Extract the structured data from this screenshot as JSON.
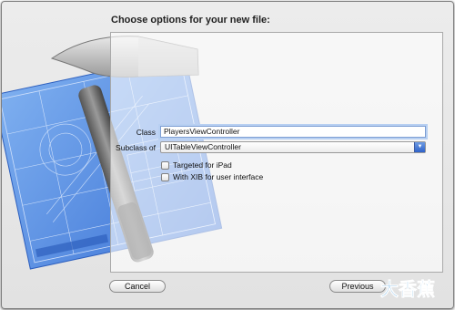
{
  "dialog": {
    "title": "Choose options for your new file:"
  },
  "form": {
    "class_label": "Class",
    "class_value": "PlayersViewController",
    "subclass_label": "Subclass of",
    "subclass_value": "UITableViewController",
    "ipad_label": "Targeted for iPad",
    "ipad_checked": false,
    "xib_label": "With XIB for user interface",
    "xib_checked": false
  },
  "footer": {
    "cancel_label": "Cancel",
    "previous_label": "Previous"
  },
  "watermark": {
    "text": "大香蕉"
  },
  "colors": {
    "focus_ring": "#b8d0f2",
    "select_arrow": "#2f62c8",
    "blueprint": "#5b8ee0"
  }
}
